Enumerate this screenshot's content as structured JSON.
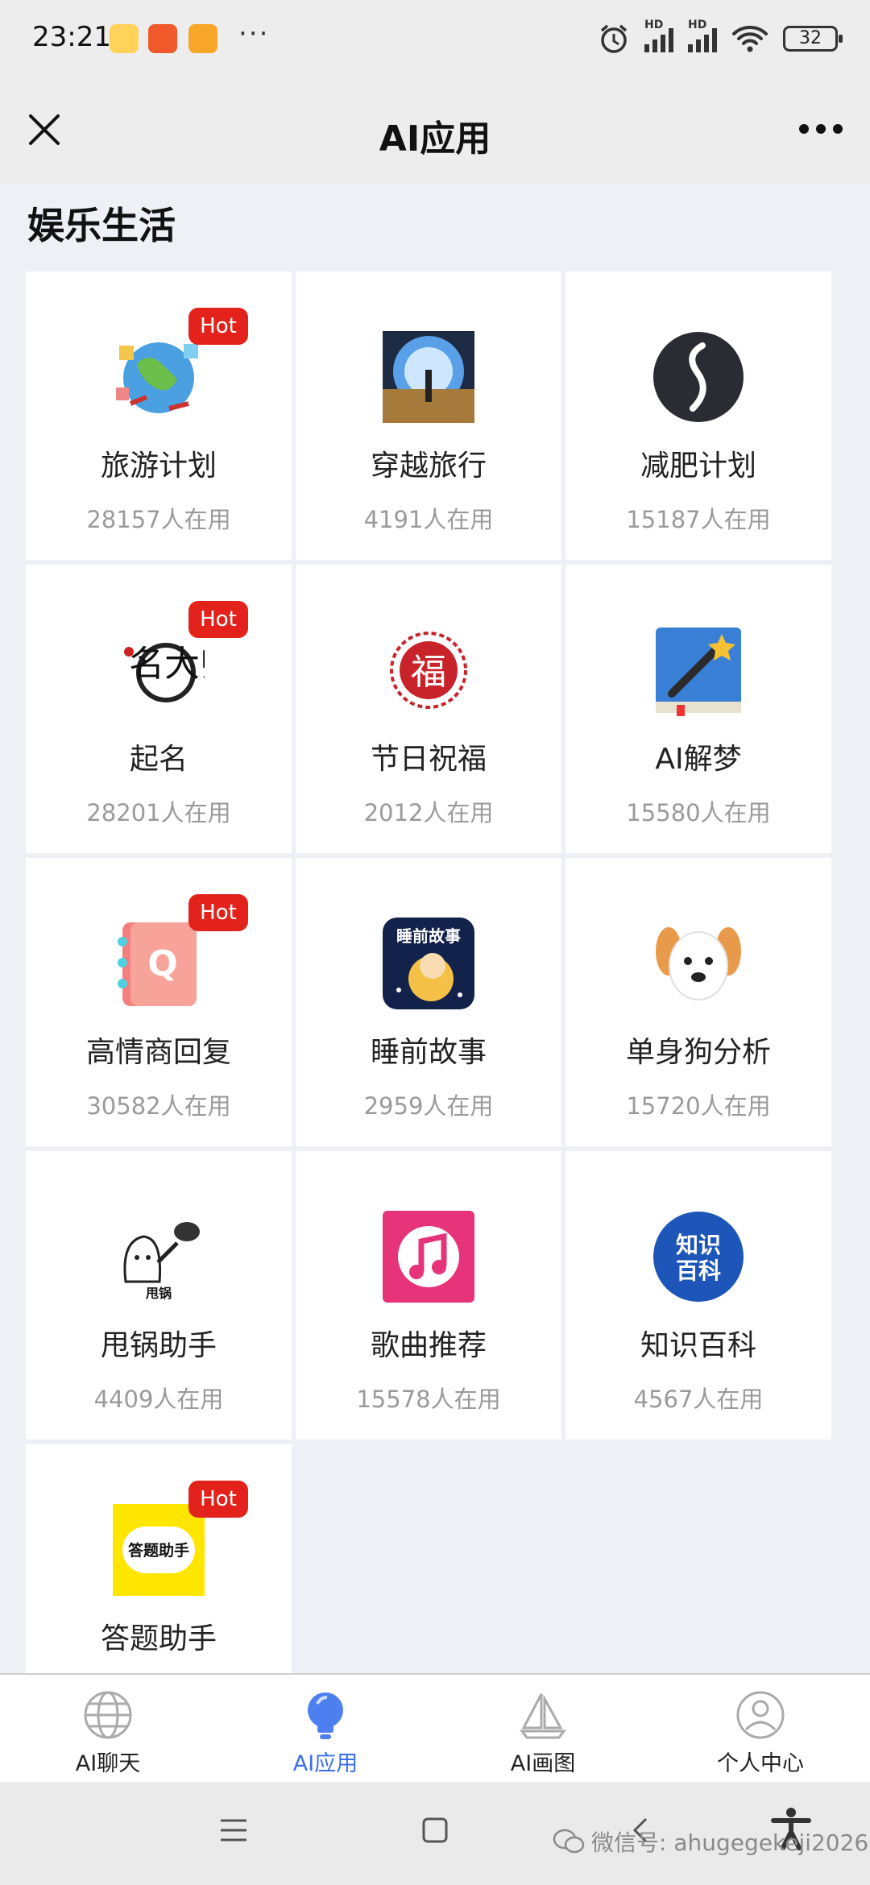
{
  "status": {
    "time": "23:21",
    "battery": "32",
    "signal_label": "HD",
    "more": "···"
  },
  "header": {
    "title": "AI应用"
  },
  "section": {
    "title": "娱乐生活"
  },
  "badge_label": "Hot",
  "apps": [
    {
      "name": "旅游计划",
      "users": "28157人在用",
      "hot": true,
      "icon": "travel-globe-icon"
    },
    {
      "name": "穿越旅行",
      "users": "4191人在用",
      "hot": false,
      "icon": "time-travel-portal-icon"
    },
    {
      "name": "减肥计划",
      "users": "15187人在用",
      "hot": false,
      "icon": "body-curve-icon"
    },
    {
      "name": "起名",
      "users": "28201人在用",
      "hot": true,
      "icon": "naming-calligraphy-icon",
      "icon_text": "名大师"
    },
    {
      "name": "节日祝福",
      "users": "2012人在用",
      "hot": false,
      "icon": "fu-blessing-icon",
      "icon_text": "福"
    },
    {
      "name": "AI解梦",
      "users": "15580人在用",
      "hot": false,
      "icon": "magic-book-icon"
    },
    {
      "name": "高情商回复",
      "users": "30582人在用",
      "hot": true,
      "icon": "notebook-q-icon",
      "icon_text": "Q"
    },
    {
      "name": "睡前故事",
      "users": "2959人在用",
      "hot": false,
      "icon": "bedtime-story-icon",
      "icon_text": "睡前故事"
    },
    {
      "name": "单身狗分析",
      "users": "15720人在用",
      "hot": false,
      "icon": "puppy-icon"
    },
    {
      "name": "甩锅助手",
      "users": "4409人在用",
      "hot": false,
      "icon": "throw-pan-icon",
      "icon_text": "甩锅"
    },
    {
      "name": "歌曲推荐",
      "users": "15578人在用",
      "hot": false,
      "icon": "music-note-icon"
    },
    {
      "name": "知识百科",
      "users": "4567人在用",
      "hot": false,
      "icon": "encyclopedia-icon",
      "icon_text": "知识百科"
    },
    {
      "name": "答题助手",
      "users": "",
      "hot": true,
      "icon": "quiz-helper-icon",
      "icon_text": "答题助手"
    }
  ],
  "bottom_nav": [
    {
      "label": "AI聊天",
      "icon": "globe-icon",
      "active": false
    },
    {
      "label": "AI应用",
      "icon": "lightbulb-icon",
      "active": true
    },
    {
      "label": "AI画图",
      "icon": "sailboat-icon",
      "active": false
    },
    {
      "label": "个人中心",
      "icon": "user-icon",
      "active": false
    }
  ],
  "watermark": "微信号: ahugegekeji2026",
  "colors": {
    "hot": "#e3221b",
    "active": "#3b6fe6",
    "background": "#eef0f6"
  }
}
